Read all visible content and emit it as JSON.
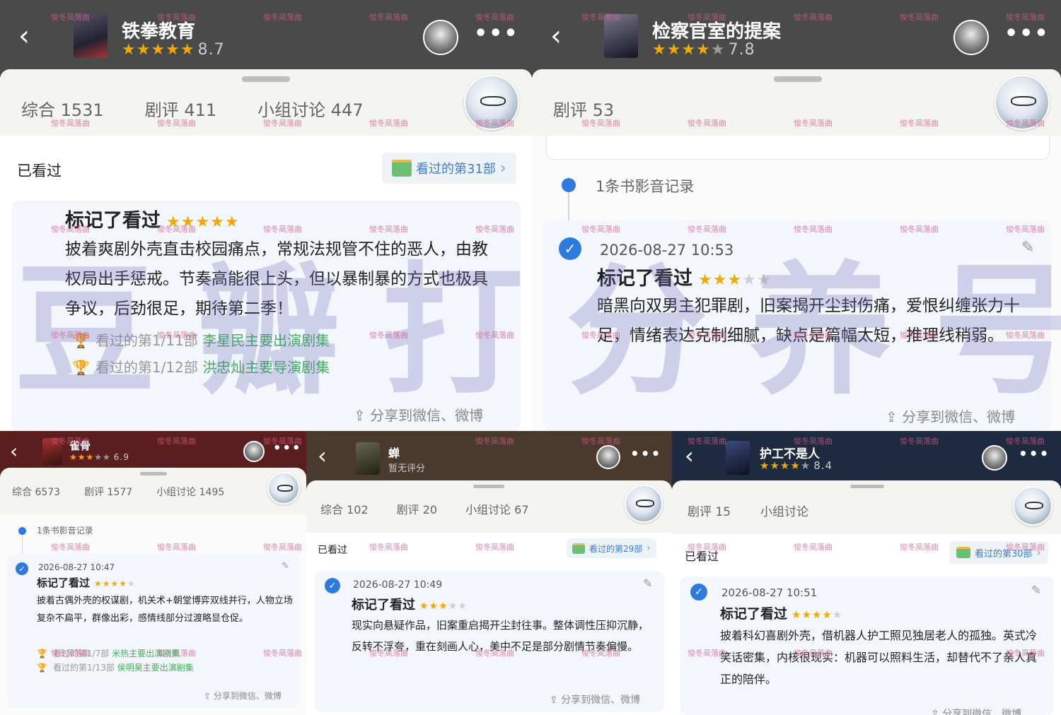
{
  "watermark_small": "悛冬凬落曲",
  "watermark_big": "豆瓣打分养号",
  "panels": {
    "p1": {
      "title": "铁拳教育",
      "stars_on": "★★★★★",
      "stars_off": "",
      "score": "8.7",
      "tabs": [
        "综合 1531",
        "剧评 411",
        "小组讨论 447"
      ],
      "seen_label": "已看过",
      "pill": "看过的第31部",
      "review_title": "标记了看过",
      "review_stars_on": "★★★★★",
      "review_stars_off": "",
      "review": "披着爽剧外壳直击校园痛点，常规法规管不住的恶人，由教权局出手惩戒。节奏高能很上头，但以暴制暴的方式也极具争议，后劲很足，期待第二季！",
      "meta1_a": "看过的第1/11部",
      "meta1_b": "李星民主要出演剧集",
      "meta2_a": "看过的第1/12部",
      "meta2_b": "洪忠灿主要导演剧集",
      "share": "分享到微信、微博"
    },
    "p2": {
      "title": "检察官室的提案",
      "stars_on": "★★★★",
      "stars_off": "★",
      "score": "7.8",
      "tabs": [
        "剧评 53"
      ],
      "record": "1条书影音记录",
      "date": "2026-08-27 10:53",
      "review_title": "标记了看过",
      "review_stars_on": "★★★",
      "review_stars_off": "★★",
      "review": "暗黑向双男主犯罪剧，旧案揭开尘封伤痛，爱恨纠缠张力十足，情绪表达克制细腻，缺点是篇幅太短，推理线稍弱。",
      "share": "分享到微信、微博"
    },
    "p3": {
      "title": "雀骨",
      "stars_on": "★★★",
      "stars_off": "★★",
      "score": "6.9",
      "tabs": [
        "综合 6573",
        "剧评 1577",
        "小组讨论 1495"
      ],
      "record": "1条书影音记录",
      "date": "2026-08-27 10:47",
      "review_title": "标记了看过",
      "review_stars_on": "★★★★",
      "review_stars_off": "★",
      "review": "披着古偶外壳的权谋剧，机关术+朝堂博弈双线并行，人物立场复杂不扁平，群像出彩，感情线部分过渡略显仓促。",
      "meta1_a": "看过的第1/7部",
      "meta1_b": "米热主要出演剧集",
      "meta2_a": "看过的第1/13部",
      "meta2_b": "侯明昊主要出演剧集",
      "share": "分享到微信、微博"
    },
    "p4": {
      "title": "蝉",
      "subtitle": "暂无评分",
      "tabs": [
        "综合 102",
        "剧评 20",
        "小组讨论 67"
      ],
      "seen_label": "已看过",
      "pill": "看过的第29部",
      "date": "2026-08-27 10:49",
      "review_title": "标记了看过",
      "review_stars_on": "★★★",
      "review_stars_off": "★★",
      "review": "现实向悬疑作品，旧案重启揭开尘封往事。整体调性压抑沉静，反转不浮夸，重在刻画人心，美中不足是部分剧情节奏偏慢。",
      "share": "分享到微信、微博"
    },
    "p5": {
      "title": "护工不是人",
      "stars_on": "★★★★",
      "stars_off": "★",
      "score": "8.4",
      "tabs": [
        "剧评 15",
        "小组讨论"
      ],
      "seen_label": "已看过",
      "pill": "看过的第30部",
      "date": "2026-08-27 10:51",
      "review_title": "标记了看过",
      "review_stars_on": "★★★★",
      "review_stars_off": "★",
      "review": "披着科幻喜剧外壳，借机器人护工照见独居老人的孤独。英式冷笑话密集，内核很现实：机器可以照料生活，却替代不了亲人真正的陪伴。",
      "share": "分享到微信、微博"
    }
  }
}
